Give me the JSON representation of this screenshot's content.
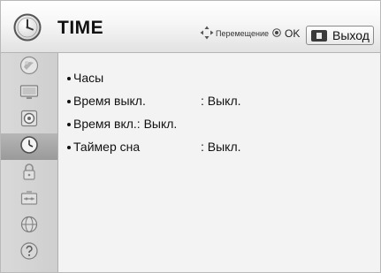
{
  "header": {
    "title": "TIME",
    "nav_hint": "Перемещение",
    "ok_label": "OK",
    "exit_label": "Выход",
    "icons": {
      "title": "clock-icon",
      "move": "four-way-arrows-icon",
      "ok": "ok-button-icon",
      "exit": "exit-key-icon"
    }
  },
  "sidebar": {
    "items": [
      {
        "icon": "picture-icon",
        "active": false
      },
      {
        "icon": "monitor-icon",
        "active": false
      },
      {
        "icon": "speaker-icon",
        "active": false
      },
      {
        "icon": "clock-icon",
        "active": true
      },
      {
        "icon": "lock-icon",
        "active": false
      },
      {
        "icon": "option-icon",
        "active": false
      },
      {
        "icon": "network-icon",
        "active": false
      },
      {
        "icon": "help-icon",
        "active": false
      }
    ]
  },
  "menu": {
    "items": [
      {
        "label": "Часы",
        "value": ""
      },
      {
        "label": "Время выкл.",
        "value": ": Выкл."
      },
      {
        "label": "Время вкл.: Выкл.",
        "value": ""
      },
      {
        "label": "Таймер сна",
        "value": ": Выкл."
      }
    ]
  },
  "colors": {
    "header_bg": "#f0f0f0",
    "sidebar_bg": "#d4d4d4",
    "active_item_bg": "#a8a8a8",
    "content_bg": "#f3f3f3"
  }
}
